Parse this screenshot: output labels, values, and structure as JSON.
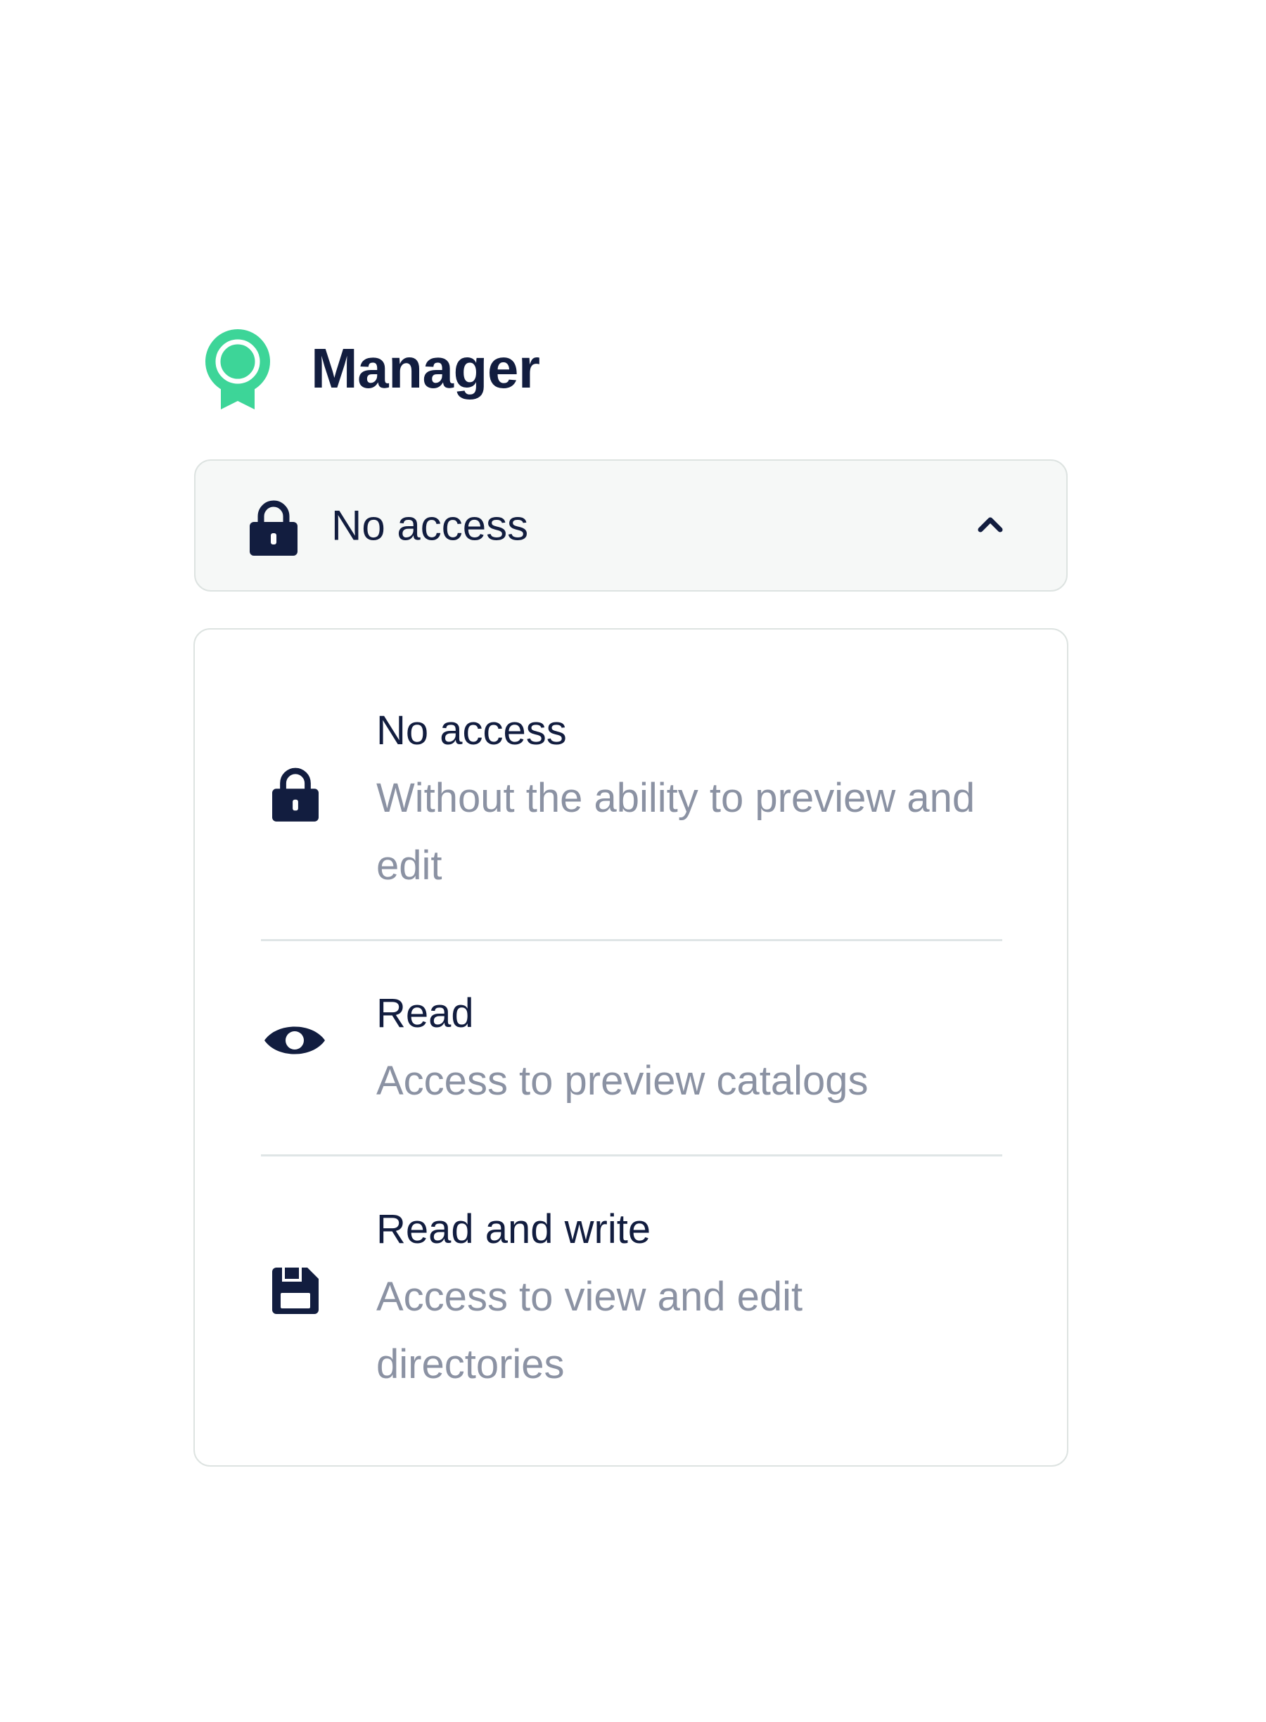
{
  "header": {
    "title": "Manager",
    "icon": "award-badge-icon",
    "icon_color": "#3dd598"
  },
  "select": {
    "value": "No access",
    "icon": "lock-icon",
    "expanded": true
  },
  "options": [
    {
      "title": "No access",
      "description": "Without the ability to preview and edit",
      "icon": "lock-icon"
    },
    {
      "title": "Read",
      "description": "Access to preview catalogs",
      "icon": "eye-icon"
    },
    {
      "title": "Read and write",
      "description": "Access to view and edit directories",
      "icon": "floppy-disk-icon"
    }
  ],
  "colors": {
    "text_primary": "#121d3f",
    "text_secondary": "#8b92a3",
    "accent": "#3dd598",
    "border": "#dde3e1",
    "select_background": "#f6f8f7"
  }
}
